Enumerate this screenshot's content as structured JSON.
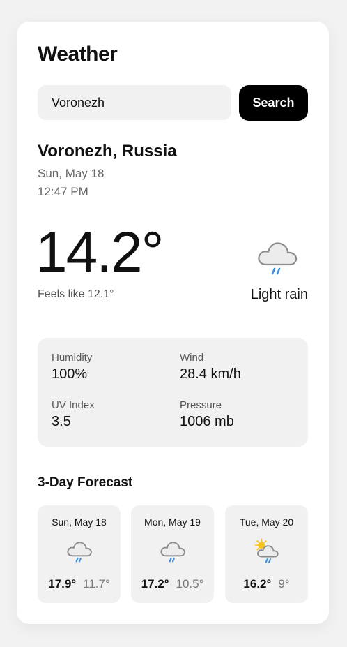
{
  "app": {
    "title": "Weather"
  },
  "search": {
    "value": "Voronezh",
    "button_label": "Search"
  },
  "current": {
    "location": "Voronezh, Russia",
    "date": "Sun, May 18",
    "time": "12:47 PM",
    "temperature": "14.2°",
    "feels_like": "Feels like 12.1°",
    "condition": "Light rain",
    "condition_icon": "cloud-rain-icon"
  },
  "details": {
    "humidity": {
      "label": "Humidity",
      "value": "100%"
    },
    "wind": {
      "label": "Wind",
      "value": "28.4 km/h"
    },
    "uv": {
      "label": "UV Index",
      "value": "3.5"
    },
    "pressure": {
      "label": "Pressure",
      "value": "1006 mb"
    }
  },
  "forecast": {
    "title": "3-Day Forecast",
    "days": [
      {
        "day": "Sun, May 18",
        "high": "17.9°",
        "low": "11.7°",
        "icon": "cloud-rain-icon"
      },
      {
        "day": "Mon, May 19",
        "high": "17.2°",
        "low": "10.5°",
        "icon": "cloud-rain-icon"
      },
      {
        "day": "Tue, May 20",
        "high": "16.2°",
        "low": "9°",
        "icon": "sun-cloud-rain-icon"
      }
    ]
  },
  "colors": {
    "background": "#f2f2f2",
    "card": "#ffffff",
    "panel": "#f1f1f1",
    "button": "#000000",
    "rain": "#3b8fe0",
    "sun": "#f7c21a"
  }
}
